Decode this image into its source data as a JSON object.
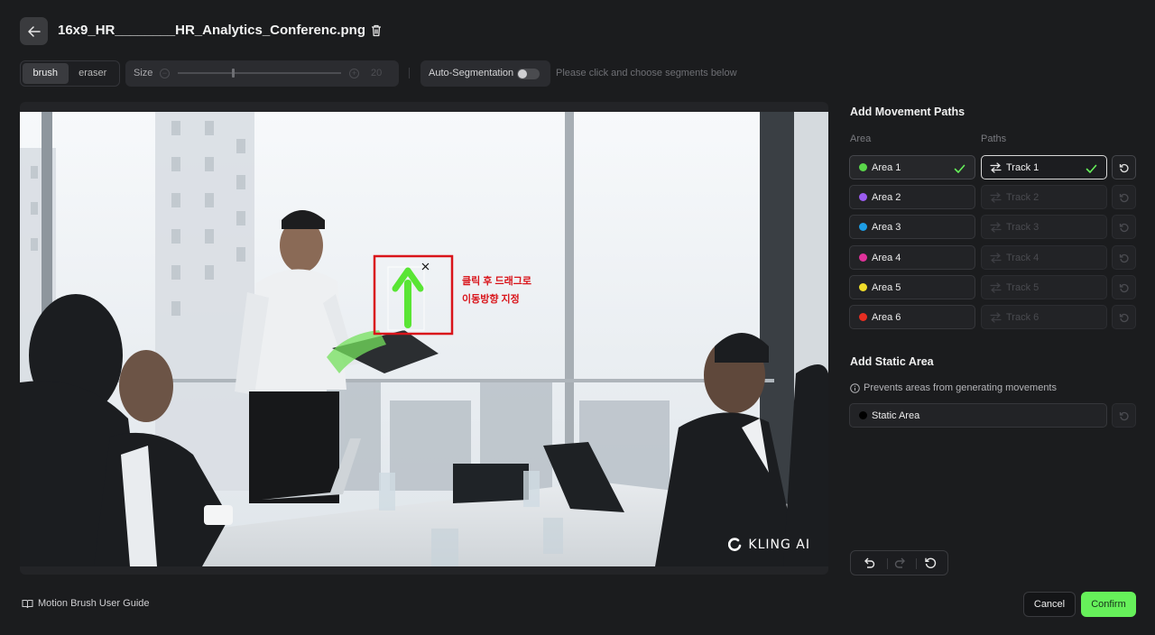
{
  "header": {
    "file_name": "16x9_HR________HR_Analytics_Conferenc.png"
  },
  "toolbar": {
    "brush_label": "brush",
    "eraser_label": "eraser",
    "size_label": "Size",
    "size_value": "20",
    "size_level_fraction": 0.33,
    "auto_segmentation_label": "Auto-Segmentation",
    "auto_segmentation_on": false,
    "hint": "Please click and choose segments below"
  },
  "canvas": {
    "watermark": "KLING AI",
    "annotation_line1": "클릭 후 드래그로",
    "annotation_line2": "이동방향 지정"
  },
  "panel": {
    "movement_title": "Add Movement Paths",
    "area_header": "Area",
    "paths_header": "Paths",
    "areas": [
      {
        "label": "Area 1",
        "color": "#5ad64a",
        "checked": true
      },
      {
        "label": "Area 2",
        "color": "#9b5cf0",
        "checked": false
      },
      {
        "label": "Area 3",
        "color": "#1e9ee6",
        "checked": false
      },
      {
        "label": "Area 4",
        "color": "#e0329a",
        "checked": false
      },
      {
        "label": "Area 5",
        "color": "#f0dc2a",
        "checked": false
      },
      {
        "label": "Area 6",
        "color": "#e62e22",
        "checked": false
      }
    ],
    "tracks": [
      {
        "label": "Track 1",
        "active": true
      },
      {
        "label": "Track 2",
        "active": false
      },
      {
        "label": "Track 3",
        "active": false
      },
      {
        "label": "Track 4",
        "active": false
      },
      {
        "label": "Track 5",
        "active": false
      },
      {
        "label": "Track 6",
        "active": false
      }
    ],
    "static_title": "Add Static Area",
    "static_hint": "Prevents areas from generating movements",
    "static_label": "Static Area",
    "static_color": "#000000"
  },
  "footer": {
    "guide_label": "Motion Brush User Guide",
    "cancel_label": "Cancel",
    "confirm_label": "Confirm"
  },
  "colors": {
    "accent_green": "#66f05a",
    "annotation_red": "#d9141a"
  }
}
